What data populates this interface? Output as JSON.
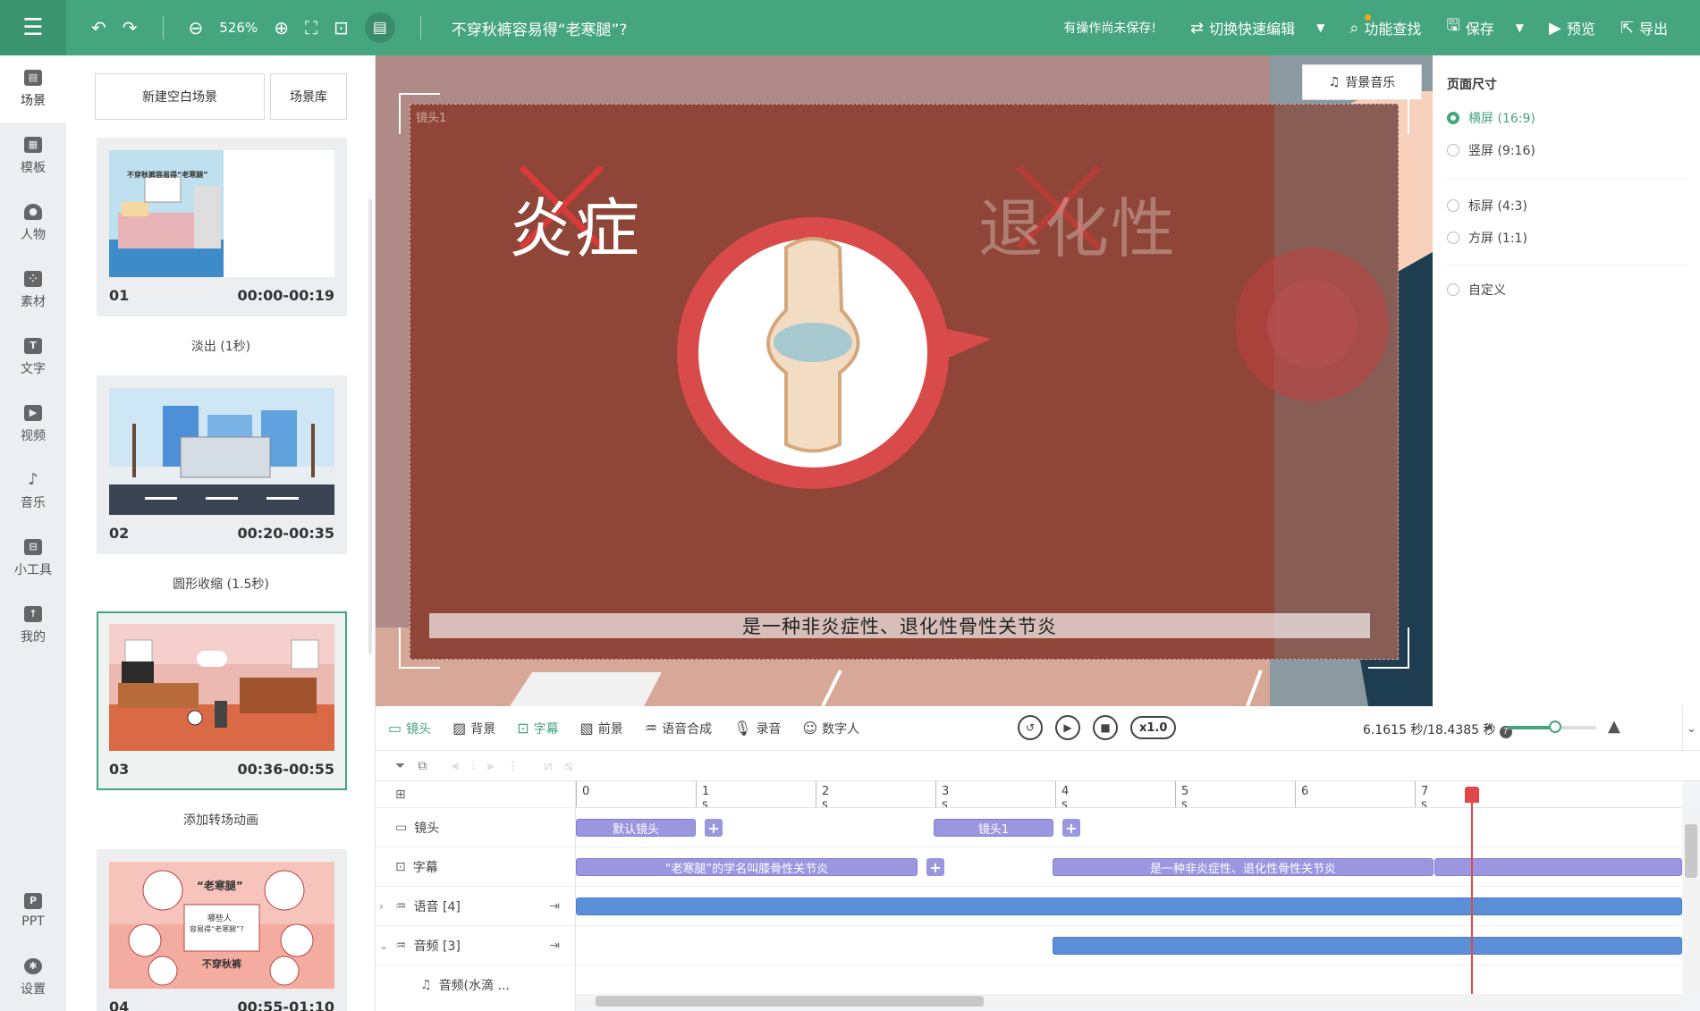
{
  "topbar": {
    "zoom": "526%",
    "title": "不穿秋裤容易得“老寒腿”?",
    "unsaved": "有操作尚未保存!",
    "quick_edit": "切换快速编辑",
    "find": "功能查找",
    "save": "保存",
    "preview": "预览",
    "export": "导出"
  },
  "rail": {
    "items": [
      "场景",
      "模板",
      "人物",
      "素材",
      "文字",
      "视频",
      "音乐",
      "小工具",
      "我的"
    ],
    "bottom": [
      "PPT",
      "设置"
    ]
  },
  "scenes": {
    "new_blank": "新建空白场景",
    "library": "场景库",
    "cards": [
      {
        "num": "01",
        "time": "00:00-00:19",
        "transition": "淡出 (1秒)"
      },
      {
        "num": "02",
        "time": "00:20-00:35",
        "transition": "圆形收缩 (1.5秒)"
      },
      {
        "num": "03",
        "time": "00:36-00:55",
        "transition": "添加转场动画"
      },
      {
        "num": "04",
        "time": "00:55-01:10"
      }
    ],
    "thumb_texts": {
      "t1": "不穿秋裤容易得“老寒腿”",
      "t4_title": "“老寒腿”",
      "t4_mid1": "哪些人",
      "t4_mid2": "容易得“老寒腿”?",
      "t4_bottom": "不穿秋裤"
    }
  },
  "stage": {
    "bgm": "背景音乐",
    "frame_label": "镜头1",
    "word_left": "炎症",
    "word_right": "退化性",
    "subtitle": "是一种非炎症性、退化性骨性关节炎"
  },
  "right_panel": {
    "title": "页面尺寸",
    "options": [
      "横屏 (16:9)",
      "竖屏 (9:16)",
      "标屏 (4:3)",
      "方屏 (1:1)",
      "自定义"
    ],
    "selected": 0
  },
  "timeline": {
    "tabs": [
      "镜头",
      "背景",
      "字幕",
      "前景",
      "语音合成",
      "录音",
      "数字人"
    ],
    "active_tabs": [
      0,
      2
    ],
    "speed": "x1.0",
    "time": "6.1615 秒/18.4385 秒",
    "ticks": [
      "0",
      "1 s",
      "2 s",
      "3 s",
      "4 s",
      "5 s",
      "6",
      "7 s"
    ],
    "tracks": [
      "镜头",
      "字幕",
      "语音 [4]",
      "音频 [3]",
      "音频(水滴 ..."
    ],
    "clips": {
      "camera_default": "默认镜头",
      "camera_1": "镜头1",
      "sub_1": "“老寒腿”的学名叫膝骨性关节炎",
      "sub_2": "是一种非炎症性、退化性骨性关节炎"
    }
  },
  "colors": {
    "accent": "#44a57f",
    "clip_purple": "#9a96e0",
    "clip_blue": "#5b8fd8",
    "playhead": "#e04848"
  }
}
